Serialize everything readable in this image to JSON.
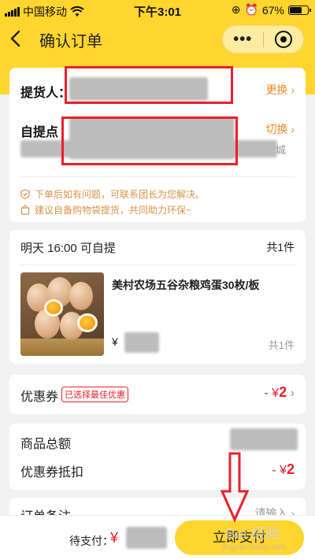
{
  "status_bar": {
    "carrier": "中国移动",
    "time": "下午3:01",
    "battery_percent": "67%",
    "battery_level": 0.67
  },
  "nav": {
    "title": "确认订单",
    "more_icon": "ellipsis-icon",
    "close_icon": "target-icon"
  },
  "pickup": {
    "person_label": "提货人：",
    "person_action": "更换",
    "point_label": "自提点",
    "point_action": "切换",
    "address_visible_fragment": "城",
    "notes": [
      "下单后如有问题，可联系团长为您解决。",
      "建议自备购物袋提货，共同助力环保~"
    ]
  },
  "order": {
    "pickup_time": "明天 16:00 可自提",
    "item_count": "共1件",
    "product": {
      "name": "美村农场五谷杂粮鸡蛋30枚/板",
      "price_prefix": "¥",
      "quantity": "共1件"
    }
  },
  "coupon": {
    "label": "优惠券",
    "tag": "已选择最佳优惠",
    "value_prefix": "- ¥",
    "value": "2"
  },
  "totals": {
    "goods_total_label": "商品总额",
    "coupon_deduction_label": "优惠券抵扣",
    "coupon_deduction_prefix": "- ¥",
    "coupon_deduction_value": "2"
  },
  "remark": {
    "label": "订单备注",
    "action": "请输入"
  },
  "bottom_bar": {
    "pay_label": "待支付：",
    "pay_currency": "¥",
    "pay_button": "立即支付"
  },
  "watermark": {
    "main": "Bai 经验",
    "sub": "jingyan.baidu.com"
  },
  "colors": {
    "brand_yellow": "#ffd52e",
    "price_red": "#e8202a",
    "action_orange": "#f08a24",
    "annotation_red": "#e8202a"
  }
}
